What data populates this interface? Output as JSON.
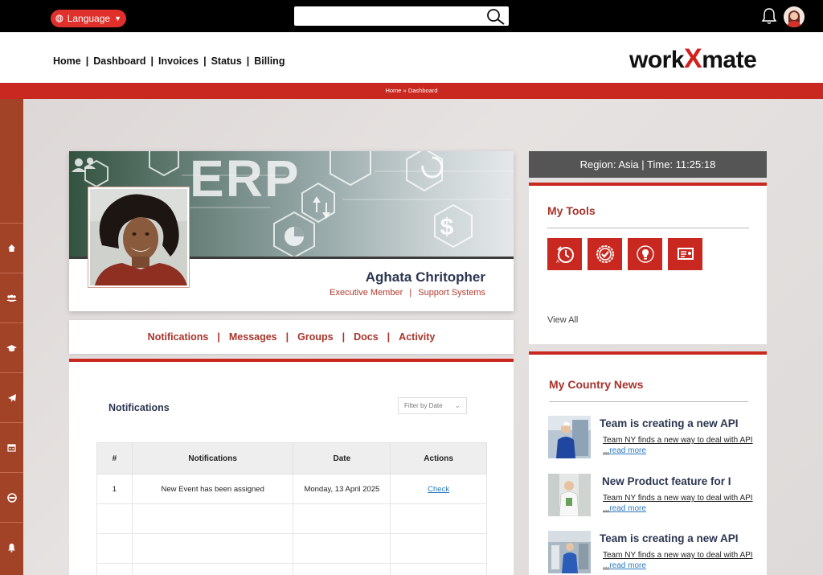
{
  "topbar": {
    "language_label": "Language",
    "search_placeholder": ""
  },
  "nav": {
    "items": [
      "Home",
      "Dashboard",
      "Invoices",
      "Status",
      "Billing"
    ],
    "separator": "|"
  },
  "logo": {
    "part1": "work",
    "part2": "X",
    "part3": "mate"
  },
  "breadcrumb": "Home »  Dashboard",
  "profile": {
    "banner_text": "ERP",
    "name": "Aghata Chritopher",
    "role": "Executive Member",
    "department": "Support Systems",
    "role_separator": "|"
  },
  "tabs": [
    "Notifications",
    "Messages",
    "Groups",
    "Docs",
    "Activity"
  ],
  "notifications": {
    "title": "Notifications",
    "filter_label": "Filter by Date",
    "columns": [
      "#",
      "Notifications",
      "Date",
      "Actions"
    ],
    "rows": [
      {
        "num": "1",
        "text": "New Event has been assigned",
        "date": "Monday, 13 April 2025",
        "action": "Check"
      }
    ]
  },
  "region": "Region: Asia | Time: 11:25:18",
  "tools": {
    "title": "My Tools",
    "icons": [
      "timer-icon",
      "check-badge-icon",
      "idea-icon",
      "board-icon"
    ],
    "view_all": "View All"
  },
  "news": {
    "title": "My Country News",
    "items": [
      {
        "headline": "Team is creating a new API",
        "body": "Team NY finds a new way to deal with API ...",
        "more": "read more"
      },
      {
        "headline": "New Product feature for I",
        "body": "Team NY finds a new way to deal with API ...",
        "more": "read more"
      },
      {
        "headline": "Team is creating a new API",
        "body": "Team NY finds a new way to deal with API ...",
        "more": "read more"
      }
    ]
  },
  "colors": {
    "accent": "#c8281f",
    "sidebar": "#a24227",
    "heading": "#2c3650"
  }
}
